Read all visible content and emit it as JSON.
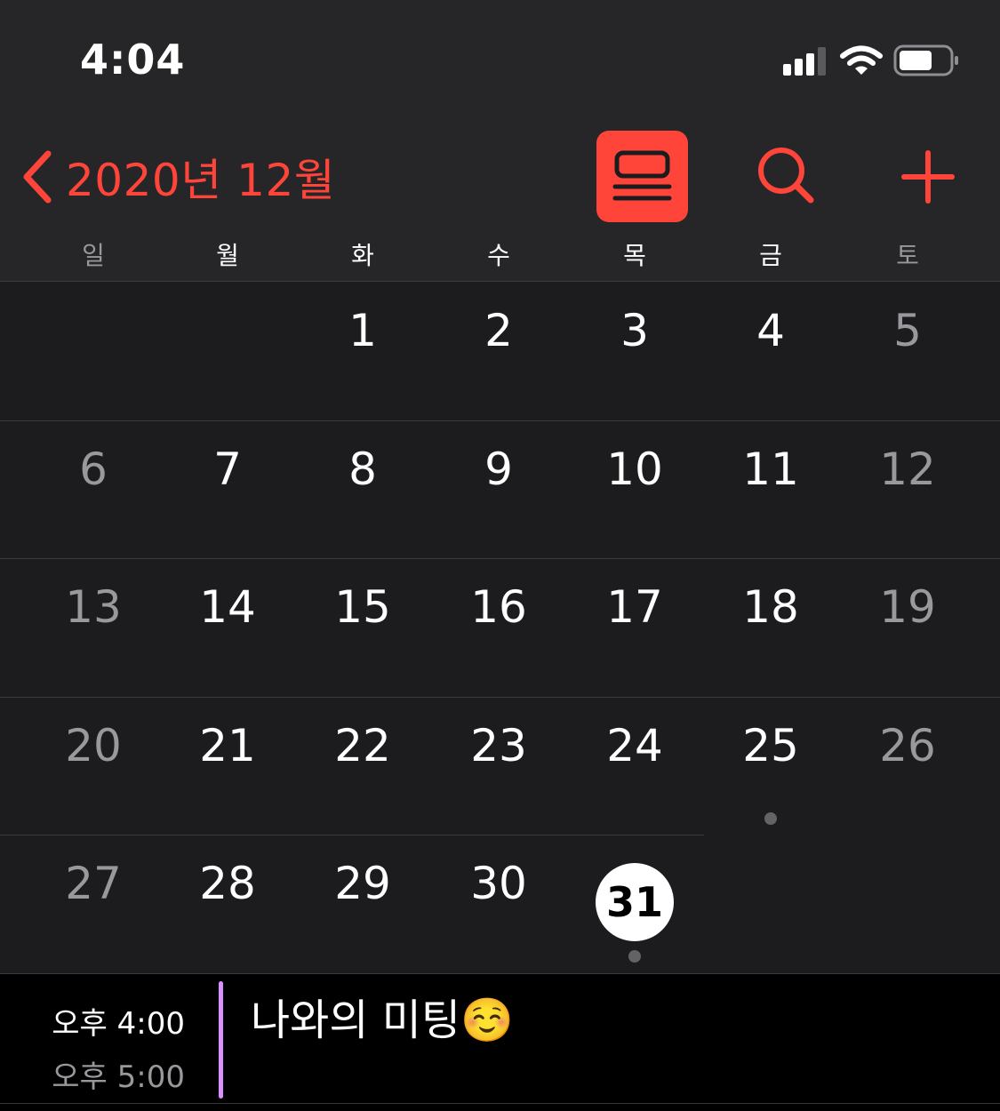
{
  "status_bar": {
    "time": "4:04",
    "icons": [
      "signal-icon",
      "wifi-icon",
      "battery-icon"
    ]
  },
  "nav": {
    "back_title": "2020년 12월",
    "buttons": [
      "list-view-icon",
      "search-icon",
      "plus-icon"
    ]
  },
  "colors": {
    "accent": "#ff453a",
    "background": "#1c1c1e",
    "header_background": "#262628",
    "event_bar": "#da8fff",
    "today_circle": "#ffffff"
  },
  "weekdays": [
    "일",
    "월",
    "화",
    "수",
    "목",
    "금",
    "토"
  ],
  "calendar": {
    "weeks": [
      [
        "",
        "",
        "1",
        "2",
        "3",
        "4",
        "5"
      ],
      [
        "6",
        "7",
        "8",
        "9",
        "10",
        "11",
        "12"
      ],
      [
        "13",
        "14",
        "15",
        "16",
        "17",
        "18",
        "19"
      ],
      [
        "20",
        "21",
        "22",
        "23",
        "24",
        "25",
        "26"
      ],
      [
        "27",
        "28",
        "29",
        "30",
        "31",
        "",
        ""
      ]
    ],
    "today": "31",
    "days_with_events": [
      "25",
      "31"
    ]
  },
  "selected_day_events": [
    {
      "start": "오후 4:00",
      "end": "오후 5:00",
      "title": "나와의 미팅☺️"
    }
  ]
}
